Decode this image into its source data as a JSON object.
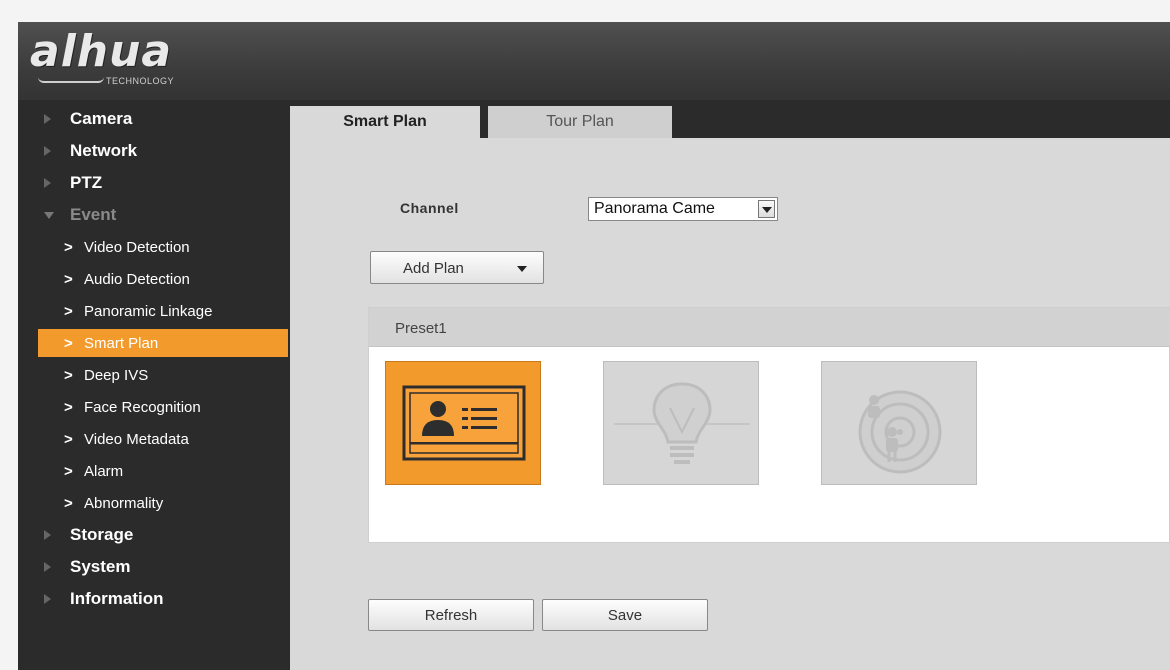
{
  "brand": {
    "name": "alhua",
    "tagline": "TECHNOLOGY"
  },
  "sidebar": {
    "items": [
      {
        "label": "Camera"
      },
      {
        "label": "Network"
      },
      {
        "label": "PTZ"
      },
      {
        "label": "Event"
      },
      {
        "label": "Storage"
      },
      {
        "label": "System"
      },
      {
        "label": "Information"
      }
    ],
    "event_sub": [
      {
        "label": "Video Detection"
      },
      {
        "label": "Audio Detection"
      },
      {
        "label": "Panoramic Linkage"
      },
      {
        "label": "Smart Plan"
      },
      {
        "label": "Deep IVS"
      },
      {
        "label": "Face Recognition"
      },
      {
        "label": "Video Metadata"
      },
      {
        "label": "Alarm"
      },
      {
        "label": "Abnormality"
      }
    ],
    "active_item": "Smart Plan",
    "chevron": ">"
  },
  "tabs": [
    {
      "label": "Smart Plan"
    },
    {
      "label": "Tour Plan"
    }
  ],
  "channel": {
    "label": "Channel",
    "value": "Panorama Came"
  },
  "add_plan": {
    "label": "Add Plan"
  },
  "preset": {
    "label": "Preset1"
  },
  "plan_icons": [
    "face-recognition-icon",
    "lightbulb-icon",
    "radar-target-icon"
  ],
  "buttons": {
    "refresh": "Refresh",
    "save": "Save"
  },
  "colors": {
    "accent": "#f39a2c",
    "sidebar_bg": "#2b2b2b",
    "content_bg": "#d9d9d9"
  }
}
